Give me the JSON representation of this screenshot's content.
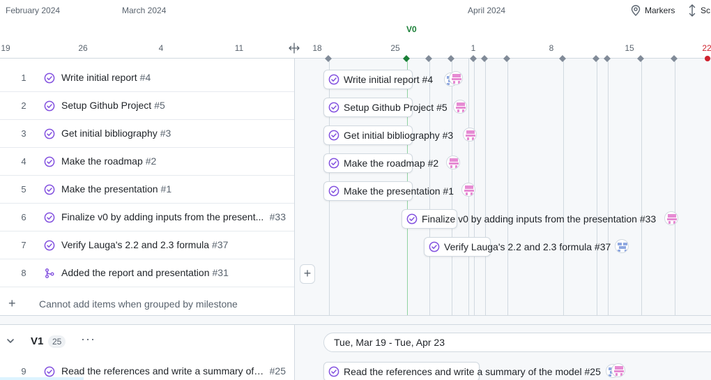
{
  "header": {
    "months": [
      "February 2024",
      "March 2024",
      "April 2024"
    ],
    "ticks": [
      "19",
      "26",
      "4",
      "11",
      "18",
      "25",
      "1",
      "8",
      "15",
      "22"
    ],
    "milestone_label": "V0",
    "markers_label": "Markers",
    "sort_label": "Sc"
  },
  "rows": [
    {
      "num": "1",
      "title": "Write initial report",
      "issue": "#4",
      "type": "issue"
    },
    {
      "num": "2",
      "title": "Setup Github Project",
      "issue": "#5",
      "type": "issue"
    },
    {
      "num": "3",
      "title": "Get initial bibliography",
      "issue": "#3",
      "type": "issue"
    },
    {
      "num": "4",
      "title": "Make the roadmap",
      "issue": "#2",
      "type": "issue"
    },
    {
      "num": "5",
      "title": "Make the presentation",
      "issue": "#1",
      "type": "issue"
    },
    {
      "num": "6",
      "title": "Finalize v0 by adding inputs from the present...",
      "issue": "#33",
      "type": "issue"
    },
    {
      "num": "7",
      "title": "Verify Lauga's 2.2 and 2.3 formula",
      "issue": "#37",
      "type": "issue"
    },
    {
      "num": "8",
      "title": "Added the report and presentation",
      "issue": "#31",
      "type": "pr"
    },
    {
      "num": "9",
      "title": "Read the references and write a summary of t...",
      "issue": "#25",
      "type": "issue"
    }
  ],
  "add_row_message": "Cannot add items when grouped by milestone",
  "group": {
    "name": "V1",
    "count": "25",
    "more": "···",
    "range": "Tue, Mar 19 - Tue, Apr 23"
  },
  "bars": [
    {
      "label": "Write initial report #4"
    },
    {
      "label": "Setup Github Project #5"
    },
    {
      "label": "Get initial bibliography #3"
    },
    {
      "label": "Make the roadmap #2"
    },
    {
      "label": "Make the presentation #1"
    },
    {
      "label": "Finalize v0 by adding inputs from the presentation #33"
    },
    {
      "label": "Verify Lauga's 2.2 and 2.3 formula #37"
    },
    {
      "label": "Read the references and write a summary of the model #25"
    }
  ],
  "colors": {
    "accent": "#8250df",
    "done": "#8250df",
    "today": "#cf222e",
    "milestone": "#1a7f37",
    "avatar_pink": "#e68bd3",
    "avatar_blue": "#8fa8e0"
  },
  "icons": {
    "status": "check-circle-icon",
    "pr": "merged-pr-icon",
    "markers": "location-pin-icon",
    "sort": "vertical-arrows-icon",
    "add": "plus-icon",
    "collapse": "chevron-down-icon"
  }
}
